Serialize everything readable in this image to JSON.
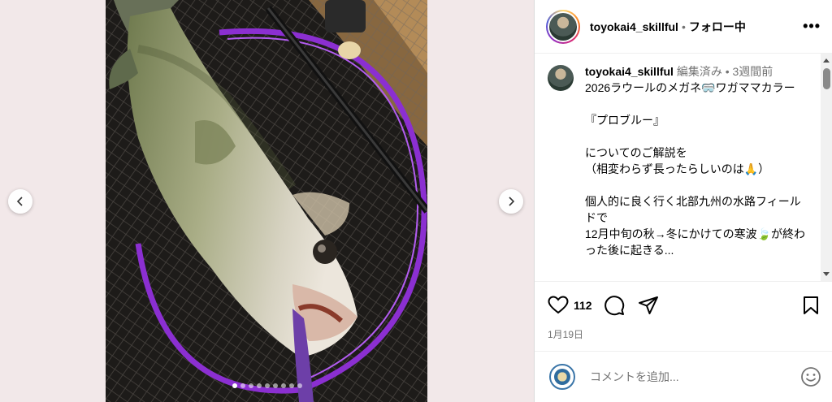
{
  "post": {
    "username": "toyokai4_skillful",
    "follow_status": "フォロー中",
    "separator": "•",
    "more_label": "•••"
  },
  "caption": {
    "username": "toyokai4_skillful",
    "edited_label": "編集済み",
    "separator": "•",
    "time_ago": "3週間前",
    "lines": [
      "2026ラウールのメガネ🥽ワガママカラー",
      "",
      "『プロブルー』",
      "",
      "についてのご解説を",
      "（相変わらず長ったらしいのは🙏）",
      "",
      "個人的に良く行く北部九州の水路フィールドで",
      "12月中旬の秋→冬にかけての寒波🍃が終わった後に起きる..."
    ]
  },
  "actions": {
    "like_count": "112",
    "date": "1月19日"
  },
  "comment": {
    "placeholder": "コメントを追加..."
  },
  "carousel": {
    "total_slides": 9,
    "active_index": 0
  },
  "icons": {
    "prev": "chevron-left-icon",
    "next": "chevron-right-icon",
    "like": "heart-icon",
    "comment": "comment-icon",
    "share": "share-icon",
    "save": "bookmark-icon",
    "emoji": "emoji-icon"
  }
}
